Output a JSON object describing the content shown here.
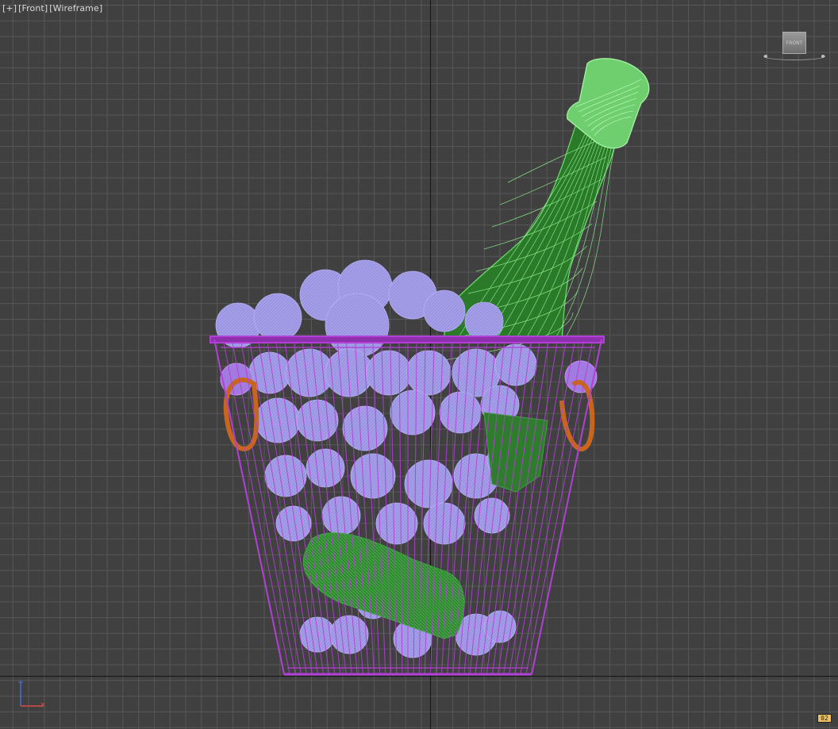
{
  "viewport": {
    "labels": [
      "[+]",
      "[Front]",
      "[Wireframe]"
    ],
    "viewcube_label": "FRONT",
    "badge": "02"
  },
  "colors": {
    "background": "#404040",
    "grid": "#575757",
    "bucket_wire": "#b23fd6",
    "ice": "#9f97e8",
    "bottle": "#2c8f2c",
    "bottle_highlight": "#7ff07f",
    "handle": "#c9661e"
  },
  "scene": {
    "objects": [
      "ice-bucket",
      "ice-cubes",
      "champagne-bottle-upright",
      "champagne-bottle-submerged",
      "handle-left",
      "handle-right"
    ]
  }
}
